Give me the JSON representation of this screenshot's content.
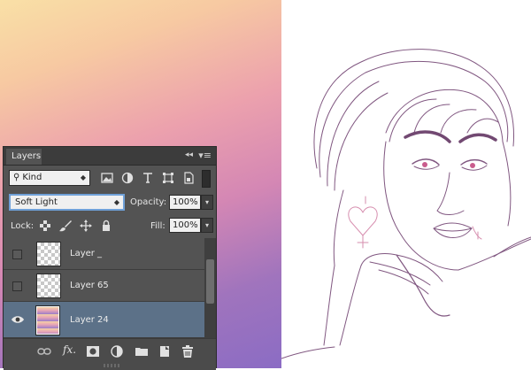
{
  "panel": {
    "tab_label": "Layers",
    "collapse_icon": "double-chevron-left-icon",
    "menu_icon": "panel-menu-icon"
  },
  "filter": {
    "kind_label": "Kind",
    "icons": [
      "image-filter-icon",
      "adjustment-filter-icon",
      "type-filter-icon",
      "shape-filter-icon",
      "smart-object-filter-icon"
    ]
  },
  "blend": {
    "mode": "Soft Light",
    "opacity_label": "Opacity:",
    "opacity_value": "100%"
  },
  "lock": {
    "label": "Lock:",
    "icons": [
      "lock-transparent-icon",
      "lock-paint-icon",
      "lock-position-icon",
      "lock-all-icon"
    ],
    "fill_label": "Fill:",
    "fill_value": "100%"
  },
  "layers": [
    {
      "name": "Layer _",
      "visible": false,
      "thumbnail": "transparent"
    },
    {
      "name": "Layer 65",
      "visible": false,
      "thumbnail": "transparent"
    },
    {
      "name": "Layer 24",
      "visible": true,
      "thumbnail": "gradient",
      "selected": true
    }
  ],
  "bottom_icons": [
    "link-layers-icon",
    "fx-icon",
    "add-mask-icon",
    "adjustment-layer-icon",
    "new-group-icon",
    "new-layer-icon",
    "trash-icon"
  ],
  "colors": {
    "panel_bg": "#535353",
    "selected_row": "#5c7188",
    "sketch_line": "#5a2a5a",
    "eye_accent": "#c0407a"
  }
}
